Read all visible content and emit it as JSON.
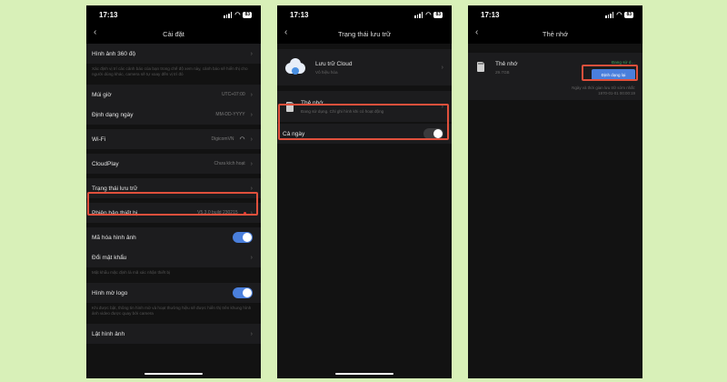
{
  "status": {
    "time": "17:13",
    "battery": "83"
  },
  "panel1": {
    "title": "Cài đặt",
    "rows": {
      "image360": "Hình ảnh 360 độ",
      "image360_desc": "Xác định vị trí các cảnh báo của bạn trong chế độ xem này, cảnh báo sẽ hiển thị cho người dùng khác, camera sẽ tự xoay đến vị trí đó",
      "timezone": "Múi giờ",
      "timezone_val": "UTC+07:00",
      "dateformat": "Định dạng ngày",
      "dateformat_val": "MM-DD-YYYY",
      "wifi": "Wi-Fi",
      "wifi_val": "DigicomVN",
      "cloudplay": "CloudPlay",
      "cloudplay_val": "Chưa kích hoạt",
      "storage": "Trạng thái lưu trữ",
      "firmware": "Phiên bản thiết bị",
      "firmware_val": "V5.3.0 build 230215",
      "encrypt": "Mã hóa hình ảnh",
      "password": "Đổi mật khẩu",
      "password_desc": "Mật khẩu mặc định là mã xác nhận thiết bị",
      "blurlogo": "Hình mờ logo",
      "blurlogo_desc": "Khi được bật, thông tin hình mờ và hoạt thường hiệu sẽ được hiển thị trên khung hình ảnh video được quay bởi camera",
      "flip": "Lật hình ảnh"
    }
  },
  "panel2": {
    "title": "Trạng thái lưu trữ",
    "cloud": {
      "title": "Lưu trữ Cloud",
      "sub": "Vô hiệu hóa"
    },
    "sd": {
      "title": "Thẻ nhớ",
      "sub": "Đang sử dụng. Chỉ ghi hình khi có hoạt động"
    },
    "allday": "Cả ngày"
  },
  "panel3": {
    "title": "Thẻ nhớ",
    "sd": {
      "name": "Thẻ nhớ",
      "size": "29.7GB",
      "status": "Đang sử d…",
      "format_btn": "Định dạng lại",
      "info1": "Ngày và thời gian lưu trữ sớm nhất:",
      "info2": "1970-01-01 00:00:19"
    }
  },
  "colors": {
    "accent": "#4a7fdc",
    "highlight": "#e0503c",
    "background": "#d8f0b8"
  }
}
